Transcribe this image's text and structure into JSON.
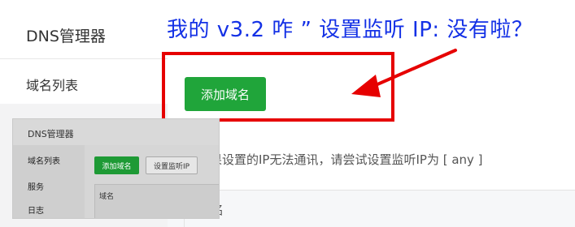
{
  "sidebar": {
    "title": "DNS管理器",
    "items": [
      {
        "label": "域名列表"
      }
    ]
  },
  "main": {
    "add_domain_button": "添加域名",
    "hint": "果设置的IP无法通讯，请尝试设置监听IP为 [ any ]",
    "table_fragment": "名"
  },
  "annotation": {
    "text": "我的 v3.2 咋 ” 设置监听 IP: 没有啦？",
    "color": "#1431e6",
    "highlight_color": "#e60000"
  },
  "thumbnail": {
    "title": "DNS管理器",
    "sidebar_items": [
      "域名列表",
      "服务",
      "日志"
    ],
    "add_button": "添加域名",
    "listen_button": "设置监听IP",
    "column_header": "域名"
  }
}
